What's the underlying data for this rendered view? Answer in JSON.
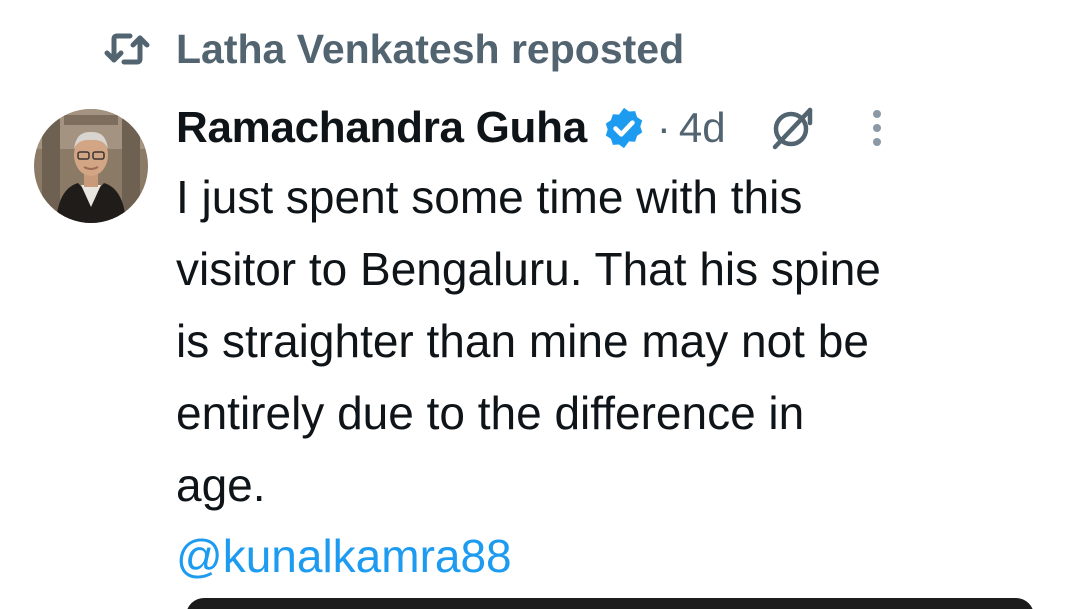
{
  "repost": {
    "icon": "repost-icon",
    "text": "Latha Venkatesh reposted"
  },
  "post": {
    "avatar": "avatar",
    "author_name": "Ramachandra Guha",
    "verified_icon": "verified-badge-icon",
    "separator": "·",
    "time": "4d",
    "grok_icon": "grok-icon",
    "more_icon": "more-options-icon",
    "body_lines": [
      "I just spent some time with this",
      "visitor to Bengaluru. That his spine",
      "is straighter than mine may not be",
      "entirely due to the difference in",
      "age."
    ],
    "mention": "@kunalkamra88",
    "media": "media-preview"
  },
  "colors": {
    "primary_text": "#0f1419",
    "secondary_text": "#536471",
    "link": "#1d9bf0",
    "verified": "#1d9bf0"
  }
}
